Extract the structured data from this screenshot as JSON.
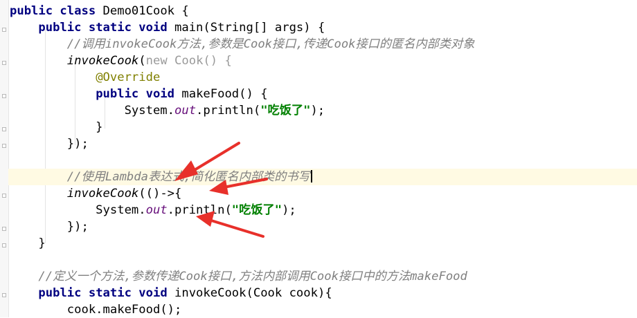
{
  "editor": {
    "lines": [
      [
        {
          "t": "public class ",
          "c": "kw"
        },
        {
          "t": "Demo01Cook {"
        }
      ],
      [
        {
          "t": "    "
        },
        {
          "t": "public static void ",
          "c": "kw"
        },
        {
          "t": "main(String[] args) {"
        }
      ],
      [
        {
          "t": "        "
        },
        {
          "t": "//调用invokeCook方法,参数是Cook接口,传递Cook接口的匿名内部类对象",
          "c": "cm"
        }
      ],
      [
        {
          "t": "        "
        },
        {
          "t": "invokeCook",
          "c": "it"
        },
        {
          "t": "("
        },
        {
          "t": "new Cook() {",
          "c": "dim"
        }
      ],
      [
        {
          "t": "            "
        },
        {
          "t": "@Override",
          "c": "ann"
        }
      ],
      [
        {
          "t": "            "
        },
        {
          "t": "public void ",
          "c": "kw"
        },
        {
          "t": "makeFood() {"
        }
      ],
      [
        {
          "t": "                System."
        },
        {
          "t": "out",
          "c": "fld"
        },
        {
          "t": ".println("
        },
        {
          "t": "\"吃饭了\"",
          "c": "str"
        },
        {
          "t": ");"
        }
      ],
      [
        {
          "t": "            }"
        }
      ],
      [
        {
          "t": "        });"
        }
      ],
      [],
      [
        {
          "t": "        "
        },
        {
          "t": "//使用Lambda表达式,简化匿名内部类的书写",
          "c": "cm"
        }
      ],
      [
        {
          "t": "        "
        },
        {
          "t": "invokeCook",
          "c": "it"
        },
        {
          "t": "(()->{"
        }
      ],
      [
        {
          "t": "            System."
        },
        {
          "t": "out",
          "c": "fld"
        },
        {
          "t": ".println("
        },
        {
          "t": "\"吃饭了\"",
          "c": "str"
        },
        {
          "t": ");"
        }
      ],
      [
        {
          "t": "        });"
        }
      ],
      [
        {
          "t": "    }"
        }
      ],
      [],
      [
        {
          "t": "    "
        },
        {
          "t": "//定义一个方法,参数传递Cook接口,方法内部调用Cook接口中的方法makeFood",
          "c": "cm"
        }
      ],
      [
        {
          "t": "    "
        },
        {
          "t": "public static void ",
          "c": "kw"
        },
        {
          "t": "invokeCook(Cook cook){"
        }
      ],
      [
        {
          "t": "        cook.makeFood();"
        }
      ]
    ],
    "current_line": 10,
    "colors": {
      "keyword": "#000080",
      "comment": "#808080",
      "annotation": "#808000",
      "string": "#008000",
      "static_field": "#660e7a",
      "arrow": "#e8302a",
      "current_line_bg": "#fffae3"
    },
    "annotation_arrows": [
      "arrow-icon",
      "arrow-icon",
      "arrow-icon"
    ]
  }
}
